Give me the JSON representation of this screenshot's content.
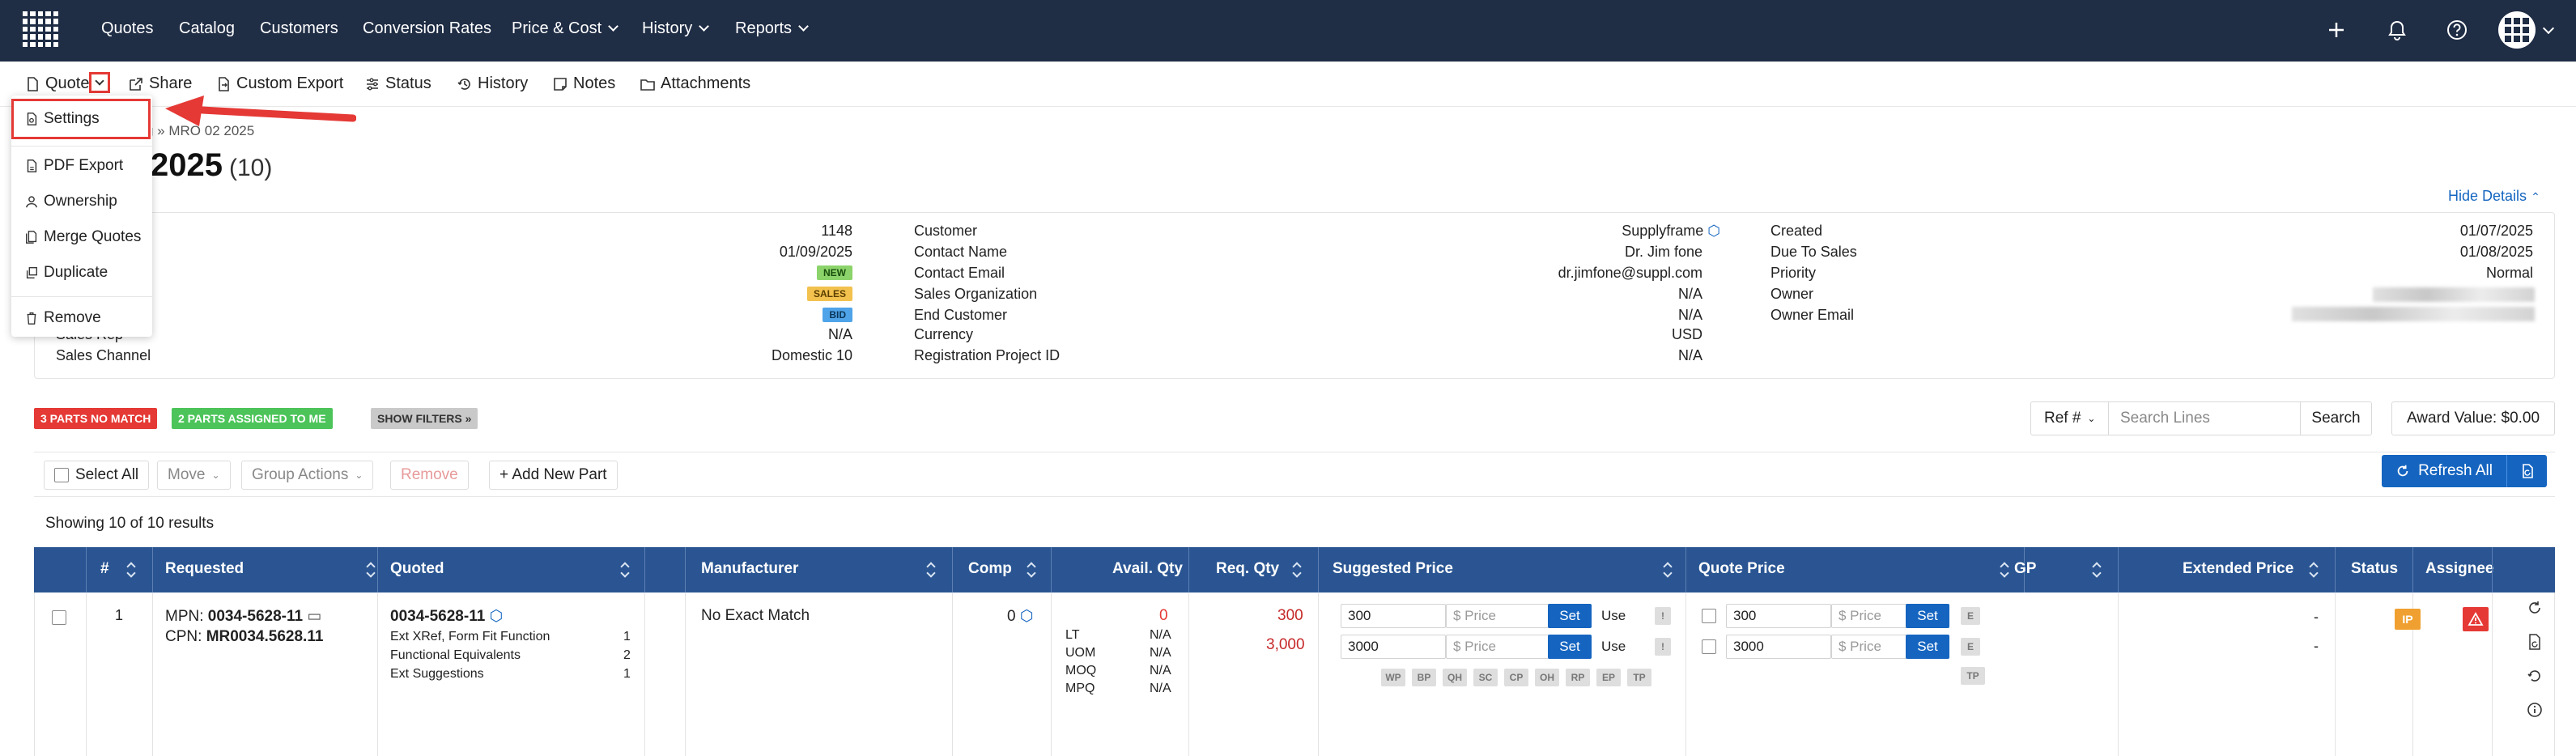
{
  "nav": {
    "items": [
      "Quotes",
      "Catalog",
      "Customers",
      "Conversion Rates",
      "Price & Cost",
      "History",
      "Reports"
    ]
  },
  "toolbar": {
    "quote": "Quote",
    "share": "Share",
    "custom_export": "Custom Export",
    "status": "Status",
    "history": "History",
    "notes": "Notes",
    "attachments": "Attachments"
  },
  "dropdown": {
    "settings": "Settings",
    "pdf_export": "PDF Export",
    "ownership": "Ownership",
    "merge_quotes": "Merge Quotes",
    "duplicate": "Duplicate",
    "remove": "Remove"
  },
  "page": {
    "breadcrumb": "g » MRO 02 2025",
    "title": "2025",
    "count": "(10)",
    "hide_details": "Hide Details"
  },
  "details": {
    "col1": {
      "values": [
        "1148",
        "01/09/2025"
      ],
      "badges": [
        {
          "label": "NEW",
          "bg": "#8bd36a",
          "fg": "#1b4d0e"
        },
        {
          "label": "SALES",
          "bg": "#f2c14e",
          "fg": "#5a3e00"
        },
        {
          "label": "BID",
          "bg": "#4fa3e8",
          "fg": "#0b3556"
        }
      ],
      "sales_rep_label": "Sales Rep",
      "sales_rep_value": "N/A",
      "sales_channel_label": "Sales Channel",
      "sales_channel_value": "Domestic 10"
    },
    "col2": {
      "labels": [
        "Customer",
        "Contact Name",
        "Contact Email",
        "Sales Organization",
        "End Customer",
        "Currency",
        "Registration Project ID"
      ],
      "values": [
        "Supplyframe",
        "Dr. Jim fone",
        "dr.jimfone@suppl.com",
        "N/A",
        "N/A",
        "USD",
        "N/A"
      ]
    },
    "col3": {
      "labels": [
        "Created",
        "Due To Sales",
        "Priority",
        "Owner",
        "Owner Email"
      ],
      "values": [
        "01/07/2025",
        "01/08/2025",
        "Normal"
      ]
    }
  },
  "filters": {
    "no_match": "3 PARTS NO MATCH",
    "assigned": "2 PARTS ASSIGNED TO ME",
    "show_filters": "SHOW FILTERS »"
  },
  "search": {
    "ref": "Ref #",
    "placeholder": "Search Lines",
    "button": "Search"
  },
  "award": {
    "label": "Award Value:",
    "value": "$0.00"
  },
  "actions": {
    "select_all": "Select All",
    "move": "Move",
    "group_actions": "Group Actions",
    "remove": "Remove",
    "add_new_part": "+ Add New Part",
    "refresh_all": "Refresh All"
  },
  "showing": "Showing 10 of 10 results",
  "table": {
    "headers": [
      "#",
      "Requested",
      "Quoted",
      "Manufacturer",
      "Comp",
      "Avail. Qty",
      "Req. Qty",
      "Suggested Price",
      "Quote Price",
      "GP",
      "Extended Price",
      "Status",
      "Assignee"
    ],
    "row": {
      "num": "1",
      "mpn_label": "MPN:",
      "mpn": "0034-5628-11",
      "cpn_label": "CPN:",
      "cpn": "MR0034.5628.11",
      "quoted_part": "0034-5628-11",
      "quoted_lines": [
        {
          "label": "Ext XRef, Form Fit Function",
          "count": "1"
        },
        {
          "label": "Functional Equivalents",
          "count": "2"
        },
        {
          "label": "Ext Suggestions",
          "count": "1"
        }
      ],
      "manufacturer": "No Exact Match",
      "comp": "0",
      "avail_top": "0",
      "avail": [
        {
          "label": "LT",
          "value": "N/A"
        },
        {
          "label": "UOM",
          "value": "N/A"
        },
        {
          "label": "MOQ",
          "value": "N/A"
        },
        {
          "label": "MPQ",
          "value": "N/A"
        }
      ],
      "req_qty": [
        "300",
        "3,000"
      ],
      "suggested": [
        {
          "qty": "300",
          "price_placeholder": "$ Price",
          "set": "Set",
          "use": "Use",
          "flag": "!"
        },
        {
          "qty": "3000",
          "price_placeholder": "$ Price",
          "set": "Set",
          "use": "Use",
          "flag": "!"
        }
      ],
      "price_tags": [
        "WP",
        "BP",
        "QH",
        "SC",
        "CP",
        "OH",
        "RP",
        "EP",
        "TP"
      ],
      "quote": [
        {
          "qty": "300",
          "price_placeholder": "$ Price",
          "set": "Set",
          "flag": "E"
        },
        {
          "qty": "3000",
          "price_placeholder": "$ Price",
          "set": "Set",
          "flag": "E"
        }
      ],
      "quote_tag": "TP",
      "extended": [
        "-",
        "-"
      ],
      "status": "IP"
    }
  },
  "colors": {
    "navbar": "#1f2d45",
    "table_header": "#2a5592",
    "primary": "#1565c0",
    "danger": "#e53935",
    "success": "#4cc45a",
    "status_ip": "#f0a030"
  }
}
